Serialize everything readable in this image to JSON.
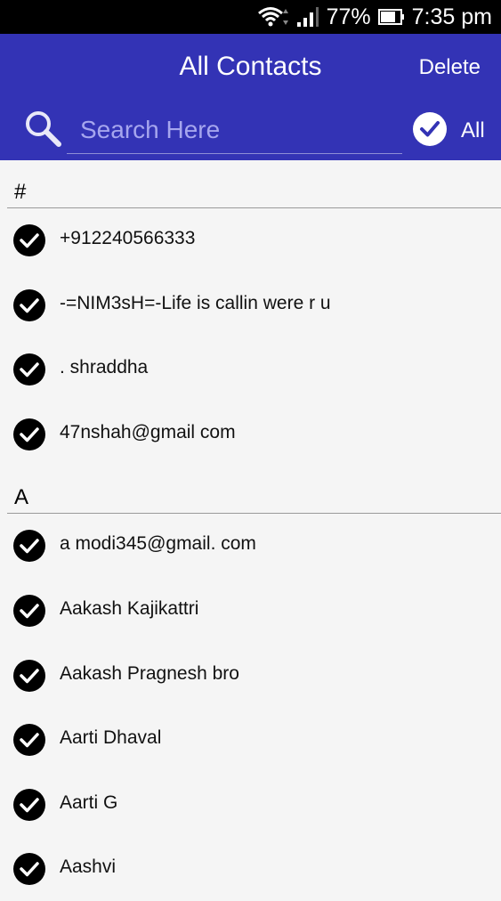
{
  "status_bar": {
    "battery": "77%",
    "time": "7:35 pm",
    "icons": [
      "wifi-icon",
      "signal-icon",
      "battery-icon"
    ]
  },
  "header": {
    "title": "All Contacts",
    "delete_label": "Delete",
    "search_placeholder": "Search Here",
    "all_label": "All",
    "background_color": "#3333b5"
  },
  "sections": [
    {
      "letter": "#",
      "contacts": [
        {
          "name": "+912240566333",
          "checked": true
        },
        {
          "name": "-=NIM3sH=-Life is callin were r u",
          "checked": true
        },
        {
          "name": ". shraddha",
          "checked": true
        },
        {
          "name": "47nshah@gmail com",
          "checked": true
        }
      ]
    },
    {
      "letter": "A",
      "contacts": [
        {
          "name": "a modi345@gmail. com",
          "checked": true
        },
        {
          "name": "Aakash Kajikattri",
          "checked": true
        },
        {
          "name": "Aakash Pragnesh bro",
          "checked": true
        },
        {
          "name": "Aarti Dhaval",
          "checked": true
        },
        {
          "name": "Aarti G",
          "checked": true
        },
        {
          "name": "Aashvi",
          "checked": true
        }
      ]
    }
  ]
}
